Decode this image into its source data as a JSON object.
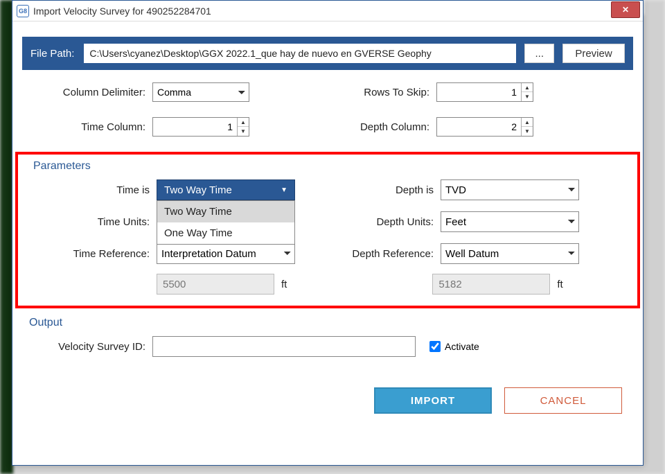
{
  "window": {
    "title": "Import Velocity Survey for 490252284701",
    "icon_text": "G8"
  },
  "file_path": {
    "label": "File Path:",
    "value": "C:\\Users\\cyanez\\Desktop\\GGX 2022.1_que hay de nuevo en GVERSE Geophy",
    "browse": "...",
    "preview": "Preview"
  },
  "top_fields": {
    "column_delimiter_label": "Column Delimiter:",
    "column_delimiter_value": "Comma",
    "rows_to_skip_label": "Rows To Skip:",
    "rows_to_skip_value": "1",
    "time_column_label": "Time Column:",
    "time_column_value": "1",
    "depth_column_label": "Depth Column:",
    "depth_column_value": "2"
  },
  "parameters": {
    "title": "Parameters",
    "time_is_label": "Time is",
    "time_is_selected": "Two Way Time",
    "time_is_options": [
      "Two Way Time",
      "One Way Time"
    ],
    "time_units_label": "Time Units:",
    "time_reference_label": "Time Reference:",
    "time_reference_value": "Interpretation Datum",
    "time_ref_value_num": "5500",
    "time_ref_unit": "ft",
    "depth_is_label": "Depth is",
    "depth_is_value": "TVD",
    "depth_units_label": "Depth Units:",
    "depth_units_value": "Feet",
    "depth_reference_label": "Depth Reference:",
    "depth_reference_value": "Well Datum",
    "depth_ref_value_num": "5182",
    "depth_ref_unit": "ft"
  },
  "output": {
    "title": "Output",
    "survey_id_label": "Velocity Survey ID:",
    "survey_id_value": "",
    "activate_label": "Activate",
    "activate_checked": true
  },
  "buttons": {
    "import": "IMPORT",
    "cancel": "CANCEL"
  }
}
